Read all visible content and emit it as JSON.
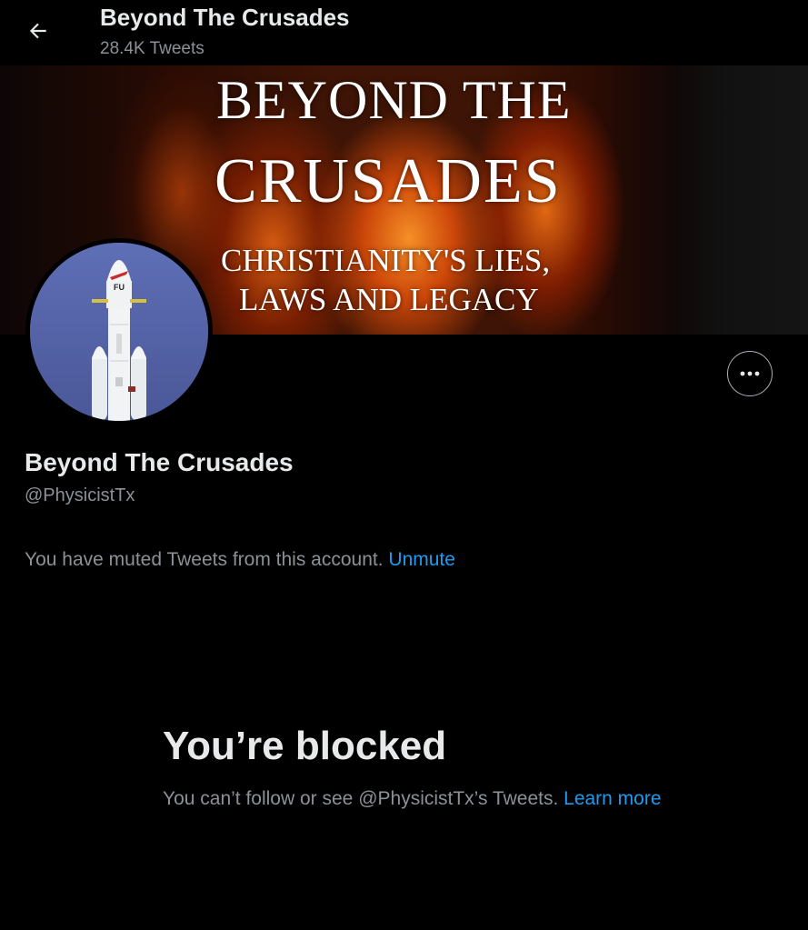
{
  "header": {
    "title": "Beyond The Crusades",
    "tweet_count": "28.4K Tweets",
    "back_icon": "arrow-left-icon"
  },
  "banner": {
    "line1": "BEYOND THE",
    "line2": "CRUSADES",
    "line3": "CHRISTIANITY'S LIES,",
    "line4": "LAWS AND LEGACY"
  },
  "avatar": {
    "rocket_text": "FU"
  },
  "more_icon": "ellipsis-icon",
  "profile": {
    "name": "Beyond The Crusades",
    "handle": "@PhysicistTx"
  },
  "muted": {
    "text": "You have muted Tweets from this account.",
    "link": "Unmute"
  },
  "blocked": {
    "title": "You’re blocked",
    "text": "You can’t follow or see @PhysicistTx’s Tweets.",
    "link": "Learn more"
  },
  "colors": {
    "background": "#000000",
    "primary_text": "#e7e9ea",
    "secondary_text": "#8b9196",
    "link": "#1d9bf0"
  }
}
